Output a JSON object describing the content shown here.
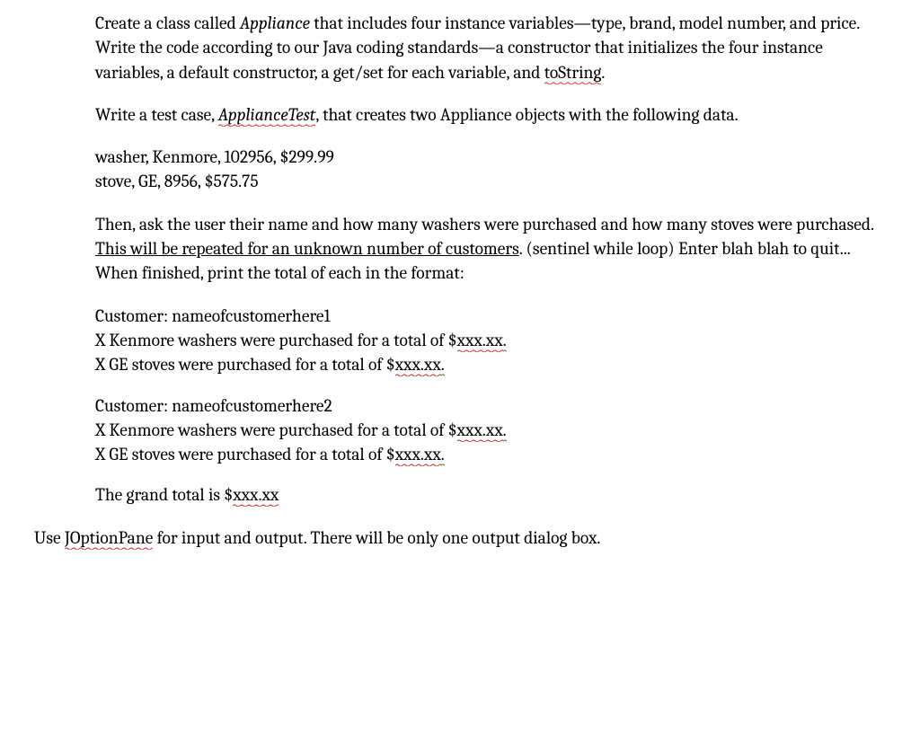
{
  "p1": {
    "t1": "Create a class called ",
    "class_name": "Appliance",
    "t2": " that includes four instance variables—type, brand, model number, and price.  Write the code according to our Java coding standards—a constructor that initializes the four instance variables, a default constructor, a get/set for each variable, and ",
    "tostring": "toString",
    "t3": "."
  },
  "p2": {
    "t1": "Write a test case, ",
    "test_name": "ApplianceTest",
    "t2": ", that creates two Appliance objects with the following data."
  },
  "data1": "washer, Kenmore, 102956, $299.99",
  "data2": "stove, GE, 8956, $575.75",
  "p3": {
    "t1": "Then, ask the user their name and how many washers were purchased and how many stoves were purchased.  ",
    "ul": "This will be repeated for an unknown number of customers",
    "t2": ". (sentinel while loop) Enter blah blah to quit... When finished, print the total of each in the format:"
  },
  "cust1": {
    "header": "Customer:  nameofcustomerhere1",
    "line_a1": "X Kenmore washers were purchased for a total of $",
    "xxx1": "xxx.xx",
    "dot1": ".",
    "line_b1": "X GE stoves were purchased for a total of $",
    "xxx2": "xxx.xx",
    "dot2": "."
  },
  "cust2": {
    "header": "Customer: nameofcustomerhere2",
    "line_a1": "X Kenmore washers were purchased for a total of $",
    "xxx1": "xxx.xx",
    "dot1": ".",
    "line_b1": "X GE stoves were purchased for a total of $",
    "xxx2": "xxx.xx",
    "dot2": "."
  },
  "grand": {
    "t1": "The grand total is $",
    "xxx": "xxx.xx"
  },
  "final": {
    "t1": "Use ",
    "jop": "JOptionPane",
    "t2": " for input and output.  There will be only one output dialog box."
  }
}
